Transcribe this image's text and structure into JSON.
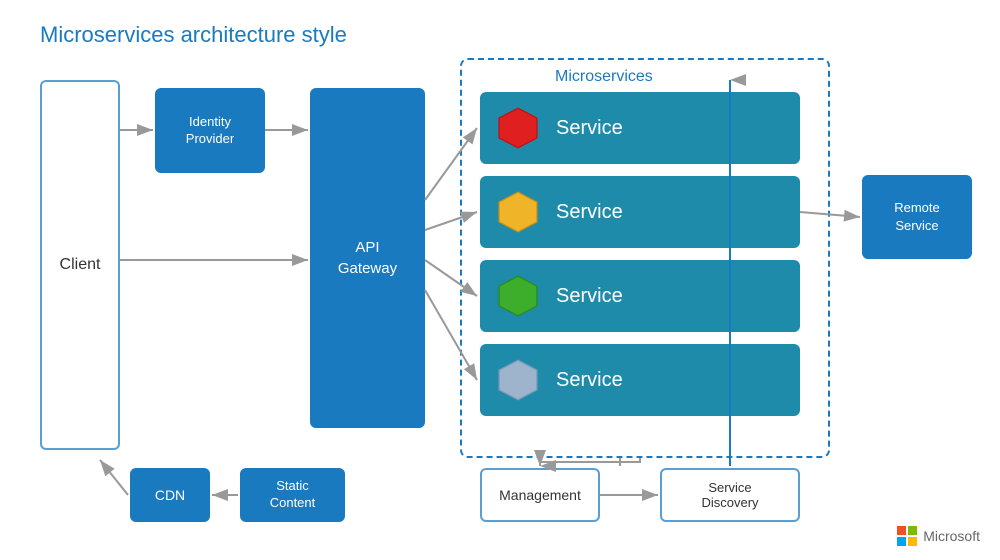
{
  "title": "Microservices architecture style",
  "client": {
    "label": "Client"
  },
  "identity_provider": {
    "label": "Identity\nProvider",
    "line1": "Identity",
    "line2": "Provider"
  },
  "api_gateway": {
    "label": "API\nGateway",
    "line1": "API",
    "line2": "Gateway"
  },
  "microservices": {
    "title": "Microservices",
    "services": [
      {
        "label": "Service",
        "hex_color": "#e02020",
        "id": "service-1"
      },
      {
        "label": "Service",
        "hex_color": "#f0b429",
        "id": "service-2"
      },
      {
        "label": "Service",
        "hex_color": "#3dae2b",
        "id": "service-3"
      },
      {
        "label": "Service",
        "hex_color": "#9db4cc",
        "id": "service-4"
      }
    ]
  },
  "remote_service": {
    "line1": "Remote",
    "line2": "Service"
  },
  "cdn": {
    "label": "CDN"
  },
  "static_content": {
    "line1": "Static",
    "line2": "Content"
  },
  "management": {
    "label": "Management"
  },
  "service_discovery": {
    "line1": "Service",
    "line2": "Discovery"
  },
  "microsoft": {
    "name": "Microsoft"
  },
  "arrow_color": "#999999"
}
